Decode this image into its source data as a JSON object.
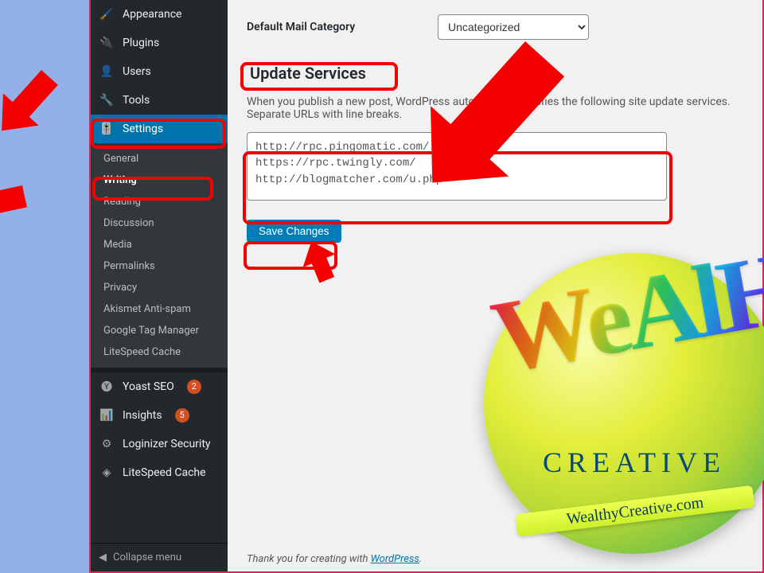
{
  "sidebar": {
    "top_items": [
      {
        "icon": "appearance-icon",
        "glyph": "🖌️",
        "label": "Appearance"
      },
      {
        "icon": "plugins-icon",
        "glyph": "🔌",
        "label": "Plugins"
      },
      {
        "icon": "users-icon",
        "glyph": "👤",
        "label": "Users"
      },
      {
        "icon": "tools-icon",
        "glyph": "🔧",
        "label": "Tools"
      },
      {
        "icon": "settings-icon",
        "glyph": "🎚️",
        "label": "Settings",
        "active": true
      }
    ],
    "settings_sub": [
      "General",
      "Writing",
      "Reading",
      "Discussion",
      "Media",
      "Permalinks",
      "Privacy",
      "Akismet Anti-spam",
      "Google Tag Manager",
      "LiteSpeed Cache"
    ],
    "settings_current": "Writing",
    "bottom_items": [
      {
        "icon": "yoast-icon",
        "label": "Yoast SEO",
        "badge": "2"
      },
      {
        "icon": "insights-icon",
        "label": "Insights",
        "badge": "5"
      },
      {
        "icon": "loginizer-icon",
        "label": "Loginizer Security"
      },
      {
        "icon": "litespeed-icon",
        "label": "LiteSpeed Cache"
      }
    ],
    "collapse_label": "Collapse menu"
  },
  "content": {
    "default_mail_label": "Default Mail Category",
    "default_mail_value": "Uncategorized",
    "section_heading": "Update Services",
    "section_desc": "When you publish a new post, WordPress automatically notifies the following site update services. Separate URLs with line breaks.",
    "ping_urls": "http://rpc.pingomatic.com/\nhttps://rpc.twingly.com/\nhttp://blogmatcher.com/u.php",
    "save_label": "Save Changes",
    "footer_prefix": "Thank you for creating with ",
    "footer_link": "WordPress",
    "footer_suffix": "."
  },
  "logo": {
    "word": "WeAlHy",
    "creative": "CREATIVE",
    "url": "WealthyCreative.com"
  }
}
